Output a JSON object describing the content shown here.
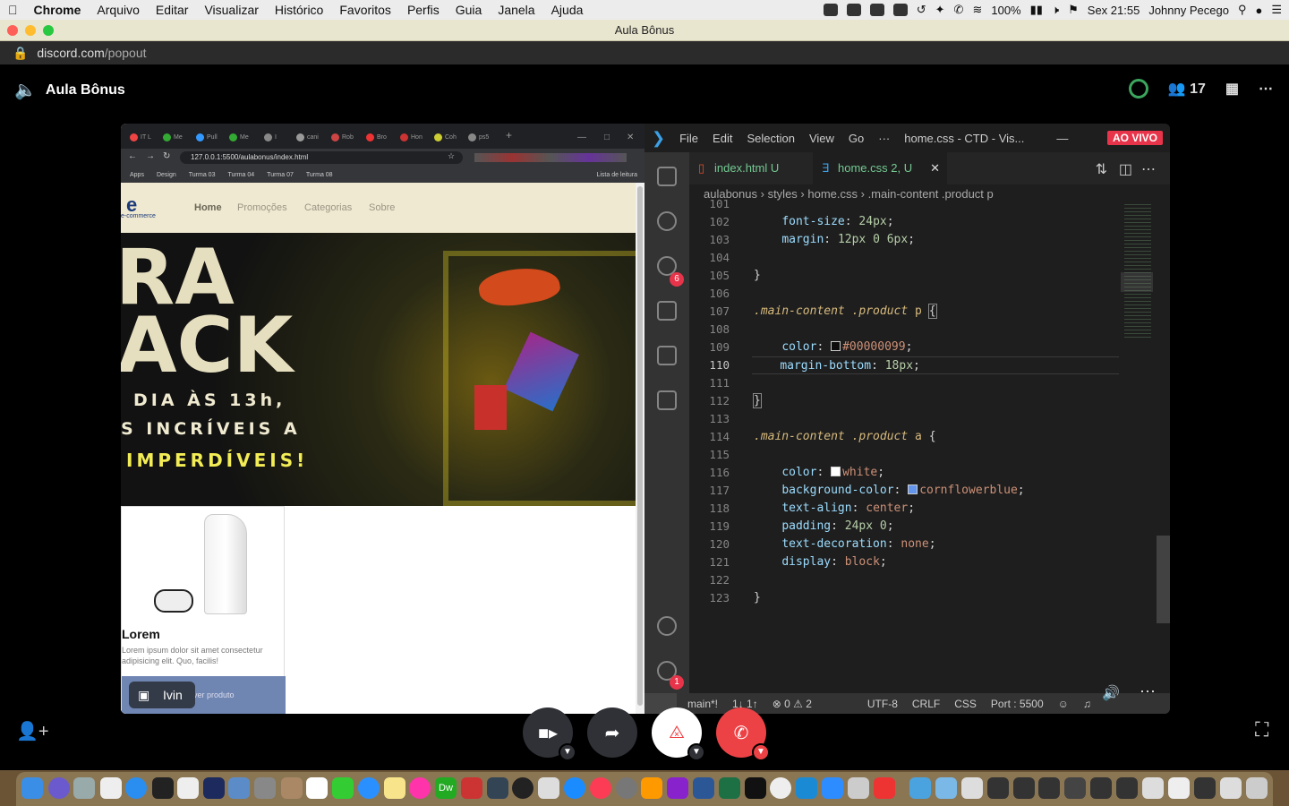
{
  "menubar": {
    "app": "Chrome",
    "items": [
      "Arquivo",
      "Editar",
      "Visualizar",
      "Histórico",
      "Favoritos",
      "Perfis",
      "Guia",
      "Janela",
      "Ajuda"
    ],
    "battery": "100%",
    "clock": "Sex 21:55",
    "user": "Johnny Pecego"
  },
  "window": {
    "title": "Aula Bônus"
  },
  "address": {
    "host": "discord.com",
    "path": "/popout"
  },
  "discord": {
    "channel": "Aula Bônus",
    "participants": "17",
    "accent_red": "#ed4245"
  },
  "browser": {
    "url": "127.0.0.1:5500/aulabonus/index.html",
    "bookmarks": [
      "Apps",
      "Design",
      "Turma 03",
      "Turma 04",
      "Turma 07",
      "Turma 08"
    ],
    "reading_list": "Lista de leitura",
    "tabs": [
      "IT L",
      "Me",
      "Pull",
      "Me",
      "I",
      "cani",
      "Rob",
      "Bro",
      "Hon",
      "Coh",
      "ps5"
    ]
  },
  "site": {
    "logo": "e",
    "logo_sub": "e-commerce",
    "nav": [
      "Home",
      "Promoções",
      "Categorias",
      "Sobre"
    ],
    "banner_big1": "RA",
    "banner_big2": "ACK",
    "banner_line1": "DIA ÀS 13h,",
    "banner_line2": "S INCRÍVEIS A",
    "banner_line3": "IMPERDÍVEIS!",
    "product_title": "Lorem",
    "product_text": "Lorem ipsum dolor sit amet consectetur adipisicing elit. Quo, facilis!",
    "product_button": "ver produto",
    "overlay_label": "Ivin"
  },
  "vscode": {
    "menus": [
      "File",
      "Edit",
      "Selection",
      "View",
      "Go",
      "···"
    ],
    "title": "home.css - CTD - Vis...",
    "live": "AO VIVO",
    "tabs": [
      {
        "label": "index.html",
        "badge": "U"
      },
      {
        "label": "home.css",
        "badge": "2, U"
      }
    ],
    "breadcrumb": [
      "aulabonus",
      "styles",
      "home.css",
      ".main-content .product p"
    ],
    "lines": [
      "101",
      "102",
      "103",
      "104",
      "105",
      "106",
      "107",
      "108",
      "109",
      "110",
      "111",
      "112",
      "113",
      "114",
      "115",
      "116",
      "117",
      "118",
      "119",
      "120",
      "121",
      "122",
      "123"
    ],
    "current_line": "110",
    "source_control_badge": "6",
    "settings_badge": "1",
    "status": {
      "branch": "main*!",
      "sync": "1↓ 1↑",
      "problems": "⊗ 0 ⚠ 2",
      "encoding": "UTF-8",
      "eol": "CRLF",
      "lang": "CSS",
      "port": "Port : 5500"
    }
  },
  "code": {
    "l102_prop": "font-size",
    "l102_val": "24px",
    "l103_prop": "margin",
    "l103_val": "12px 0 6px",
    "l107_sel1": ".main-content",
    "l107_sel2": ".product",
    "l107_sel3": "p",
    "l109_prop": "color",
    "l109_val": "#00000099",
    "l110_prop": "margin-bottom",
    "l110_val": "18px",
    "l114_sel1": ".main-content",
    "l114_sel2": ".product",
    "l114_sel3": "a",
    "l116_prop": "color",
    "l116_val": "white",
    "l117_prop": "background-color",
    "l117_val": "cornflowerblue",
    "l118_prop": "text-align",
    "l118_val": "center",
    "l119_prop": "padding",
    "l119_val": "24px 0",
    "l120_prop": "text-decoration",
    "l120_val": "none",
    "l121_prop": "display",
    "l121_val": "block"
  }
}
